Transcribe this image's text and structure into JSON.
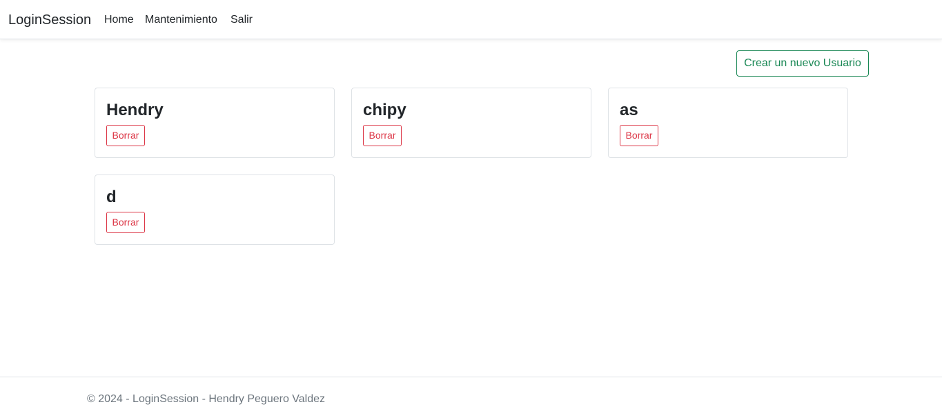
{
  "navbar": {
    "brand": "LoginSession",
    "links": [
      "Home",
      "Mantenimiento",
      "Salir"
    ]
  },
  "main": {
    "create_button_label": "Crear un nuevo Usuario",
    "delete_label": "Borrar",
    "users": [
      "Hendry",
      "chipy",
      "as",
      "d"
    ]
  },
  "footer": {
    "text": "© 2024 - LoginSession - Hendry Peguero Valdez"
  },
  "colors": {
    "success": "#198754",
    "danger": "#dc3545",
    "muted": "#6c757d",
    "border": "#dee2e6"
  }
}
